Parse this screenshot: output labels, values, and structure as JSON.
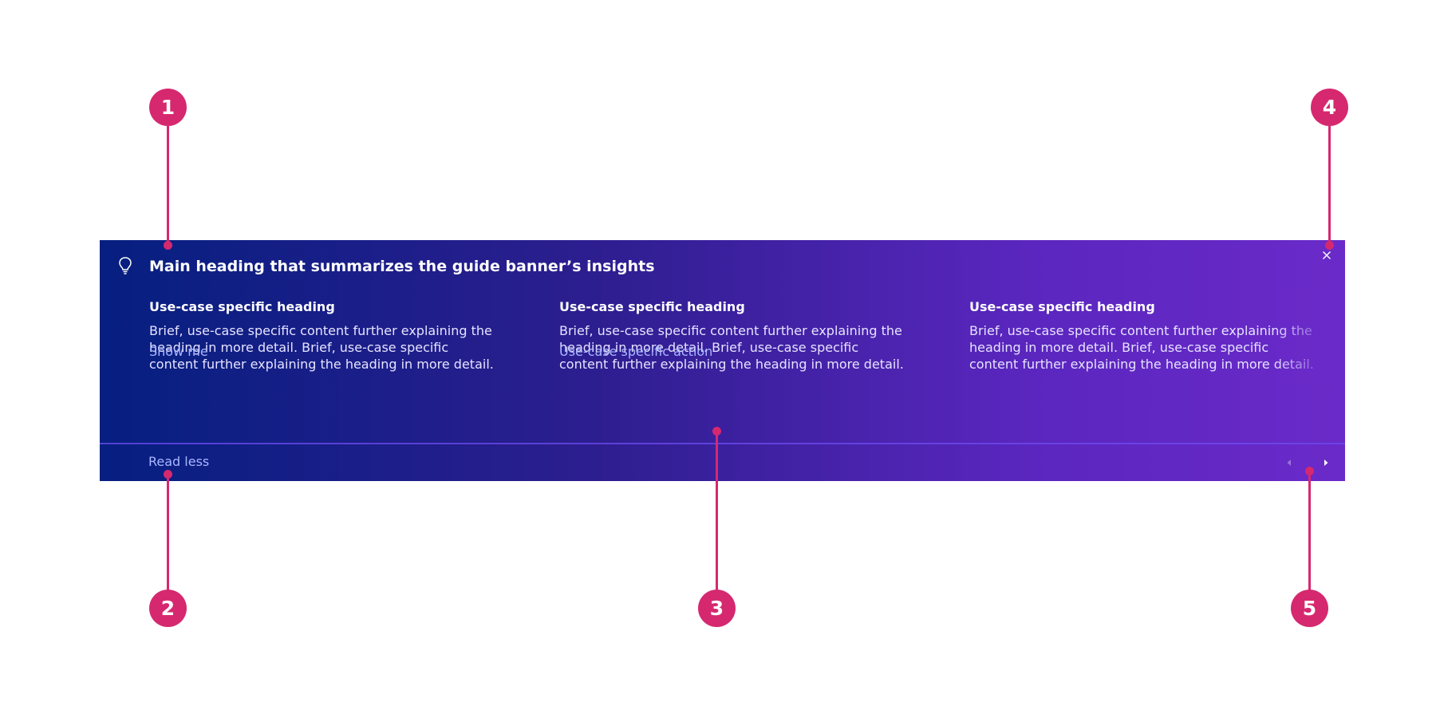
{
  "banner": {
    "icon": "lightbulb-icon",
    "heading": "Main heading that summarizes the guide banner’s insights",
    "close_label": "×",
    "columns": [
      {
        "heading": "Use-case specific heading",
        "body": "Brief, use-case specific content further explaining the heading in more detail. Brief, use-case specific content further explaining the heading in more detail.",
        "action": "Show me"
      },
      {
        "heading": "Use-case specific heading",
        "body": "Brief, use-case specific content further explaining the heading in more detail. Brief, use-case specific content further explaining the heading in more detail.",
        "action": "Use-case specific action"
      },
      {
        "heading": "Use-case specific heading",
        "body": "Brief, use-case specific content further explaining the heading in more detail. Brief, use-case specific content further explaining the heading in more detail."
      }
    ],
    "read_less": "Read less",
    "nav": {
      "prev_icon": "caret-left-icon",
      "next_icon": "caret-right-icon"
    },
    "colors": {
      "gradient_start": "#061f80",
      "gradient_end": "#6a2ac9",
      "link": "#a9b6ff"
    }
  },
  "callouts": [
    {
      "number": "1"
    },
    {
      "number": "2"
    },
    {
      "number": "3"
    },
    {
      "number": "4"
    },
    {
      "number": "5"
    }
  ],
  "callout_color": "#d6286f"
}
